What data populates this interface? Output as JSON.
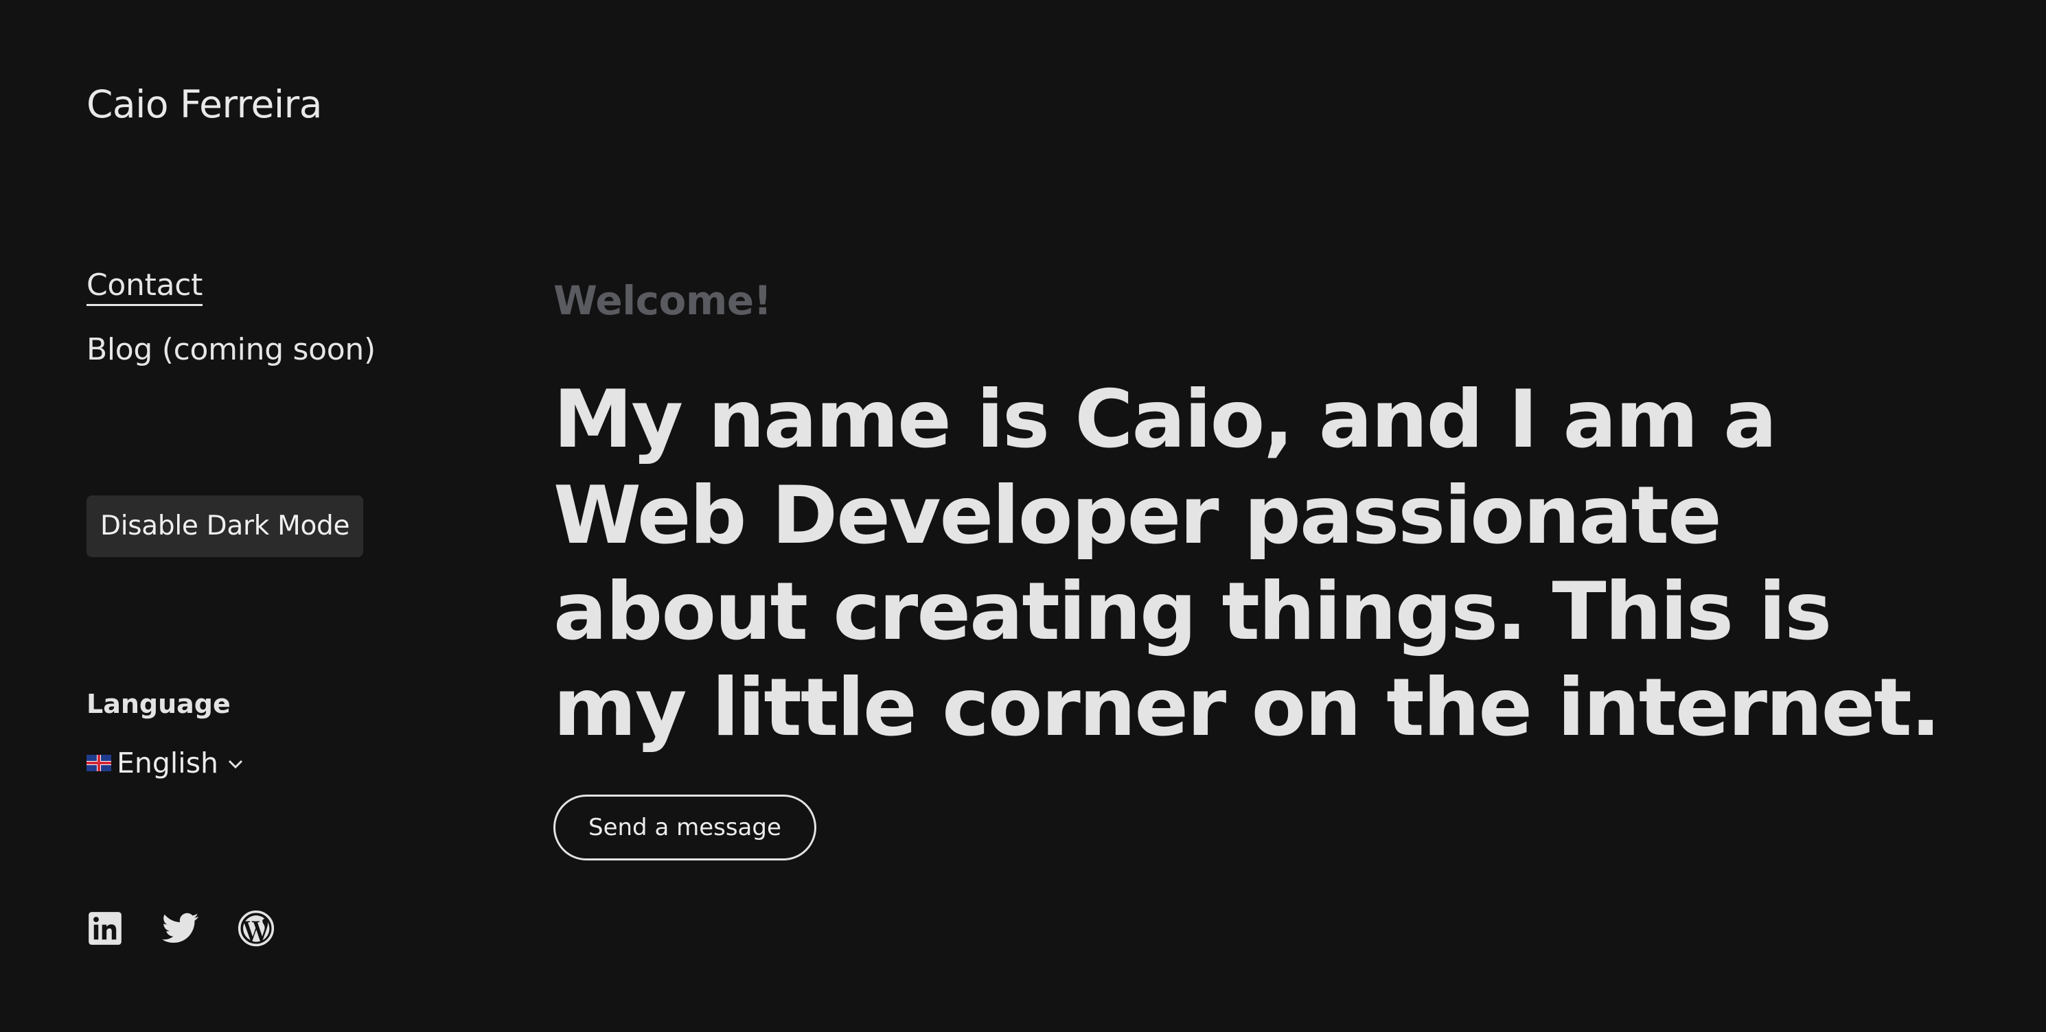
{
  "site": {
    "title": "Caio Ferreira"
  },
  "nav": {
    "items": [
      {
        "label": "Contact",
        "active": true
      },
      {
        "label": "Blog (coming soon)",
        "active": false
      }
    ]
  },
  "theme_toggle": {
    "label": "Disable Dark Mode"
  },
  "language": {
    "heading": "Language",
    "selected": "English"
  },
  "social": [
    {
      "icon": "linkedin-icon"
    },
    {
      "icon": "twitter-icon"
    },
    {
      "icon": "wordpress-icon"
    }
  ],
  "hero": {
    "welcome": "Welcome!",
    "headline": "My name is Caio, and I am a Web Developer passionate about creating things. This is my little corner on the internet.",
    "cta_label": "Send a message"
  },
  "colors": {
    "background": "#121212",
    "text": "#e3e3e3",
    "muted": "#5a5b61",
    "button_bg": "#2b2b2b"
  }
}
